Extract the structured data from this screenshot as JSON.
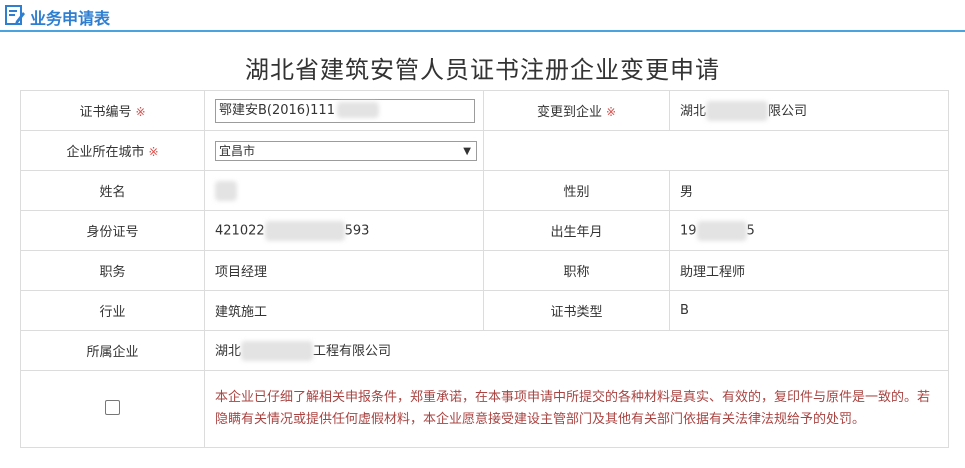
{
  "header": {
    "title": "业务申请表",
    "icon": "edit-form-icon",
    "accent": "#2e7ed1"
  },
  "page_title": "湖北省建筑安管人员证书注册企业变更申请",
  "form": {
    "cert_no": {
      "label": "证书编号",
      "required_mark": "※",
      "value": "鄂建安B(2016)111"
    },
    "target_company": {
      "label": "变更到企业",
      "required_mark": "※",
      "value_prefix": "湖北",
      "value_suffix": "限公司"
    },
    "city": {
      "label": "企业所在城市",
      "required_mark": "※",
      "selected": "宜昌市"
    },
    "name": {
      "label": "姓名",
      "value": ""
    },
    "gender": {
      "label": "性别",
      "value": "男"
    },
    "id_no": {
      "label": "身份证号",
      "value_prefix": "421022",
      "value_suffix": "593"
    },
    "birth": {
      "label": "出生年月",
      "value_prefix": "19",
      "value_suffix": "5"
    },
    "position": {
      "label": "职务",
      "value": "项目经理"
    },
    "title": {
      "label": "职称",
      "value": "助理工程师"
    },
    "industry": {
      "label": "行业",
      "value": "建筑施工"
    },
    "cert_type": {
      "label": "证书类型",
      "value": "B"
    },
    "company": {
      "label": "所属企业",
      "value_prefix": "湖北",
      "value_suffix": "工程有限公司"
    },
    "declaration": "本企业已仔细了解相关申报条件，郑重承诺，在本事项申请中所提交的各种材料是真实、有效的，复印件与原件是一致的。若隐瞒有关情况或提供任何虚假材料，本企业愿意接受建设主管部门及其他有关部门依据有关法律法规给予的处罚。"
  }
}
